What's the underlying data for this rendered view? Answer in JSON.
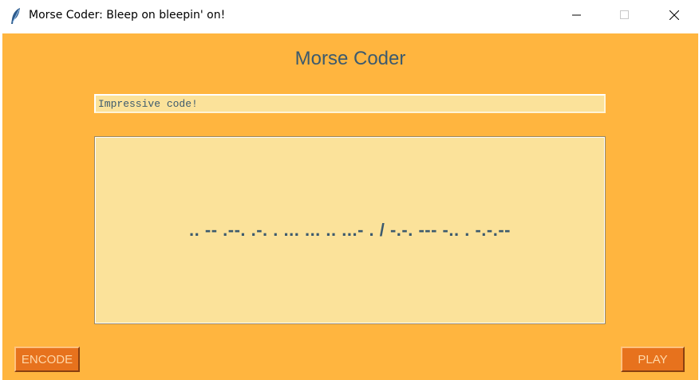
{
  "window": {
    "title": "Morse Coder: Bleep on bleepin' on!",
    "icon": "feather-icon",
    "controls": [
      "minimize-icon",
      "maximize-icon",
      "close-icon"
    ]
  },
  "app": {
    "heading": "Morse Coder",
    "input_value": "Impressive code!",
    "output_text": ".. -- .--. .-. . ... ... .. ...- . / -.-. --- -.. . -.-.--",
    "encode_label": "ENCODE",
    "play_label": "PLAY"
  },
  "colors": {
    "background": "#ffb53f",
    "field": "#fbe29a",
    "text": "#3c5a6e",
    "button": "#e7721d",
    "button_text": "#ffd7a8"
  }
}
